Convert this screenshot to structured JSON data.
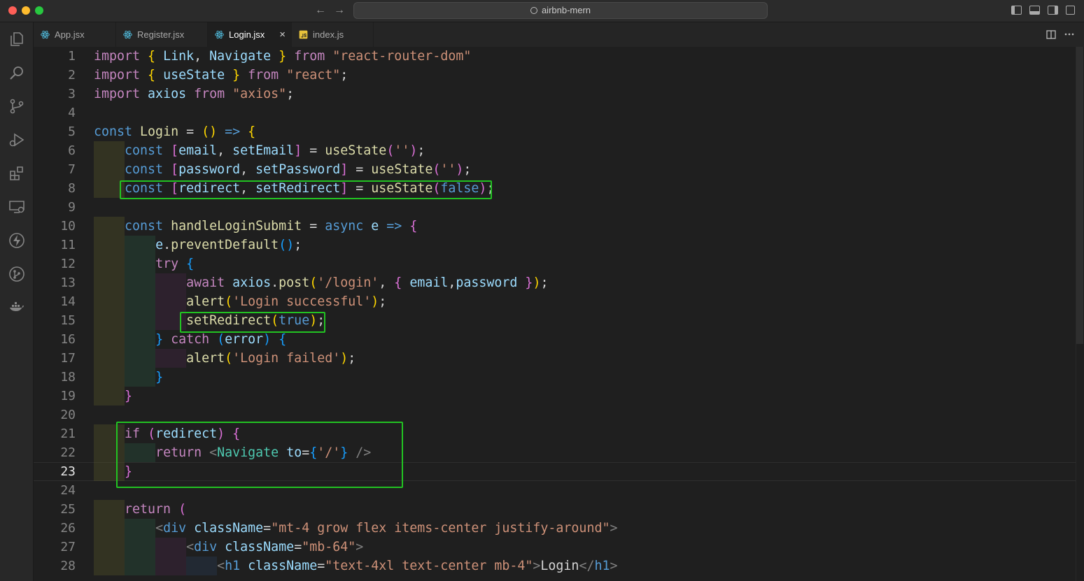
{
  "window": {
    "title": "airbnb-mern"
  },
  "tabs": [
    {
      "label": "App.jsx",
      "icon": "react-icon"
    },
    {
      "label": "Register.jsx",
      "icon": "react-icon"
    },
    {
      "label": "Login.jsx",
      "icon": "react-icon",
      "active": true,
      "close": "×"
    },
    {
      "label": "index.js",
      "icon": "js-icon"
    }
  ],
  "nav": {
    "back": "←",
    "forward": "→"
  },
  "editor": {
    "current_line": 23,
    "line_numbers": [
      "1",
      "2",
      "3",
      "4",
      "5",
      "6",
      "7",
      "8",
      "9",
      "10",
      "11",
      "12",
      "13",
      "14",
      "15",
      "16",
      "17",
      "18",
      "19",
      "20",
      "21",
      "22",
      "23",
      "24",
      "25",
      "26",
      "27",
      "28"
    ],
    "lines": [
      [
        [
          "kw",
          "import "
        ],
        [
          "br1",
          "{ "
        ],
        [
          "vr",
          "Link"
        ],
        [
          "pn",
          ", "
        ],
        [
          "vr",
          "Navigate"
        ],
        [
          "br1",
          " }"
        ],
        [
          "kw",
          " from "
        ],
        [
          "str",
          "\"react-router-dom\""
        ]
      ],
      [
        [
          "kw",
          "import "
        ],
        [
          "br1",
          "{ "
        ],
        [
          "vr",
          "useState"
        ],
        [
          "br1",
          " }"
        ],
        [
          "kw",
          " from "
        ],
        [
          "str",
          "\"react\""
        ],
        [
          "pn",
          ";"
        ]
      ],
      [
        [
          "kw",
          "import "
        ],
        [
          "vr",
          "axios"
        ],
        [
          "kw",
          " from "
        ],
        [
          "str",
          "\"axios\""
        ],
        [
          "pn",
          ";"
        ]
      ],
      [],
      [
        [
          "kb",
          "const "
        ],
        [
          "fn",
          "Login"
        ],
        [
          "pn",
          " = "
        ],
        [
          "br1",
          "()"
        ],
        [
          "kb",
          " => "
        ],
        [
          "br1",
          "{"
        ]
      ],
      [
        [
          "pn",
          "    "
        ],
        [
          "kb",
          "const "
        ],
        [
          "br2",
          "["
        ],
        [
          "vr",
          "email"
        ],
        [
          "pn",
          ", "
        ],
        [
          "vr",
          "setEmail"
        ],
        [
          "br2",
          "]"
        ],
        [
          "pn",
          " = "
        ],
        [
          "fn",
          "useState"
        ],
        [
          "br2",
          "("
        ],
        [
          "str",
          "''"
        ],
        [
          "br2",
          ")"
        ],
        [
          "pn",
          ";"
        ]
      ],
      [
        [
          "pn",
          "    "
        ],
        [
          "kb",
          "const "
        ],
        [
          "br2",
          "["
        ],
        [
          "vr",
          "password"
        ],
        [
          "pn",
          ", "
        ],
        [
          "vr",
          "setPassword"
        ],
        [
          "br2",
          "]"
        ],
        [
          "pn",
          " = "
        ],
        [
          "fn",
          "useState"
        ],
        [
          "br2",
          "("
        ],
        [
          "str",
          "''"
        ],
        [
          "br2",
          ")"
        ],
        [
          "pn",
          ";"
        ]
      ],
      [
        [
          "pn",
          "    "
        ],
        [
          "kb",
          "const "
        ],
        [
          "br2",
          "["
        ],
        [
          "vr",
          "redirect"
        ],
        [
          "pn",
          ", "
        ],
        [
          "vr",
          "setRedirect"
        ],
        [
          "br2",
          "]"
        ],
        [
          "pn",
          " = "
        ],
        [
          "fn",
          "useState"
        ],
        [
          "br2",
          "("
        ],
        [
          "kb",
          "false"
        ],
        [
          "br2",
          ")"
        ],
        [
          "pn",
          ";"
        ]
      ],
      [],
      [
        [
          "pn",
          "    "
        ],
        [
          "kb",
          "const "
        ],
        [
          "fn",
          "handleLoginSubmit"
        ],
        [
          "pn",
          " = "
        ],
        [
          "kb",
          "async "
        ],
        [
          "vr",
          "e"
        ],
        [
          "kb",
          " => "
        ],
        [
          "br2",
          "{"
        ]
      ],
      [
        [
          "pn",
          "        "
        ],
        [
          "vr",
          "e"
        ],
        [
          "pn",
          "."
        ],
        [
          "fn",
          "preventDefault"
        ],
        [
          "br3",
          "()"
        ],
        [
          "pn",
          ";"
        ]
      ],
      [
        [
          "pn",
          "        "
        ],
        [
          "kw",
          "try "
        ],
        [
          "br3",
          "{"
        ]
      ],
      [
        [
          "pn",
          "            "
        ],
        [
          "kw",
          "await "
        ],
        [
          "vr",
          "axios"
        ],
        [
          "pn",
          "."
        ],
        [
          "fn",
          "post"
        ],
        [
          "br1",
          "("
        ],
        [
          "str",
          "'/login'"
        ],
        [
          "pn",
          ", "
        ],
        [
          "br2",
          "{ "
        ],
        [
          "vr",
          "email"
        ],
        [
          "pn",
          ","
        ],
        [
          "vr",
          "password"
        ],
        [
          "br2",
          " }"
        ],
        [
          "br1",
          ")"
        ],
        [
          "pn",
          ";"
        ]
      ],
      [
        [
          "pn",
          "            "
        ],
        [
          "fn",
          "alert"
        ],
        [
          "br1",
          "("
        ],
        [
          "str",
          "'Login successful'"
        ],
        [
          "br1",
          ")"
        ],
        [
          "pn",
          ";"
        ]
      ],
      [
        [
          "pn",
          "            "
        ],
        [
          "fn",
          "setRedirect"
        ],
        [
          "br1",
          "("
        ],
        [
          "kb",
          "true"
        ],
        [
          "br1",
          ")"
        ],
        [
          "pn",
          ";"
        ]
      ],
      [
        [
          "pn",
          "        "
        ],
        [
          "br3",
          "}"
        ],
        [
          "kw",
          " catch "
        ],
        [
          "br3",
          "("
        ],
        [
          "vr",
          "error"
        ],
        [
          "br3",
          ")"
        ],
        [
          "br3",
          " {"
        ]
      ],
      [
        [
          "pn",
          "            "
        ],
        [
          "fn",
          "alert"
        ],
        [
          "br1",
          "("
        ],
        [
          "str",
          "'Login failed'"
        ],
        [
          "br1",
          ")"
        ],
        [
          "pn",
          ";"
        ]
      ],
      [
        [
          "pn",
          "        "
        ],
        [
          "br3",
          "}"
        ]
      ],
      [
        [
          "pn",
          "    "
        ],
        [
          "br2",
          "}"
        ]
      ],
      [],
      [
        [
          "pn",
          "    "
        ],
        [
          "kw",
          "if "
        ],
        [
          "br2",
          "("
        ],
        [
          "vr",
          "redirect"
        ],
        [
          "br2",
          ")"
        ],
        [
          "br2",
          " {"
        ]
      ],
      [
        [
          "pn",
          "        "
        ],
        [
          "kw",
          "return "
        ],
        [
          "gt",
          "<"
        ],
        [
          "tg",
          "Navigate"
        ],
        [
          "vr",
          " to"
        ],
        [
          "pn",
          "="
        ],
        [
          "br3",
          "{"
        ],
        [
          "str",
          "'/'"
        ],
        [
          "br3",
          "}"
        ],
        [
          "gt",
          " />"
        ]
      ],
      [
        [
          "pn",
          "    "
        ],
        [
          "br2",
          "}"
        ]
      ],
      [],
      [
        [
          "pn",
          "    "
        ],
        [
          "kw",
          "return "
        ],
        [
          "br2",
          "("
        ]
      ],
      [
        [
          "pn",
          "        "
        ],
        [
          "gt",
          "<"
        ],
        [
          "kb",
          "div"
        ],
        [
          "vr",
          " className"
        ],
        [
          "pn",
          "="
        ],
        [
          "str",
          "\"mt-4 grow flex items-center justify-around\""
        ],
        [
          "gt",
          ">"
        ]
      ],
      [
        [
          "pn",
          "            "
        ],
        [
          "gt",
          "<"
        ],
        [
          "kb",
          "div"
        ],
        [
          "vr",
          " className"
        ],
        [
          "pn",
          "="
        ],
        [
          "str",
          "\"mb-64\""
        ],
        [
          "gt",
          ">"
        ]
      ],
      [
        [
          "pn",
          "                "
        ],
        [
          "gt",
          "<"
        ],
        [
          "kb",
          "h1"
        ],
        [
          "vr",
          " className"
        ],
        [
          "pn",
          "="
        ],
        [
          "str",
          "\"text-4xl text-center mb-4\""
        ],
        [
          "gt",
          ">"
        ],
        [
          "tx",
          "Login"
        ],
        [
          "gt",
          "</"
        ],
        [
          "kb",
          "h1"
        ],
        [
          "gt",
          ">"
        ]
      ]
    ]
  }
}
